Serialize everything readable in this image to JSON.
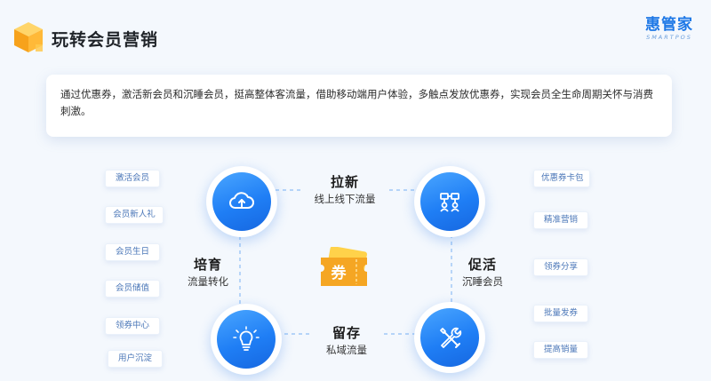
{
  "header": {
    "title": "玩转会员营销",
    "brand_name": "惠管家",
    "brand_sub": "SMARTPOS"
  },
  "intro": {
    "text": "通过优惠券，激活新会员和沉睡会员，挺高整体客流量，借助移动端用户体验，多触点发放优惠券，实现会员全生命周期关怀与消费刺激。"
  },
  "left_tags": [
    "激活会员",
    "会员新人礼",
    "会员生日",
    "会员储值",
    "领券中心",
    "用户沉淀"
  ],
  "right_tags": [
    "优惠券卡包",
    "精准营销",
    "领券分享",
    "批量发券",
    "提高销量"
  ],
  "quadrants": {
    "top": {
      "title": "拉新",
      "sub": "线上线下流量",
      "icon": "cloud-upload-icon"
    },
    "right": {
      "title": "促活",
      "sub": "沉睡会员",
      "icon": "people-network-icon"
    },
    "bottom": {
      "title": "留存",
      "sub": "私域流量",
      "icon": "tools-icon"
    },
    "left": {
      "title": "培育",
      "sub": "流量转化",
      "icon": "lightbulb-icon"
    }
  },
  "center": {
    "ticket_text": "券",
    "icon": "coupon-ticket-icon"
  },
  "colors": {
    "accent": "#1f7ef5",
    "accent_light": "#4aa6ff",
    "ticket_orange": "#f5a623",
    "ticket_yellow": "#ffd24a",
    "tag_text": "#4b77b8",
    "background": "#f4f8fd"
  }
}
